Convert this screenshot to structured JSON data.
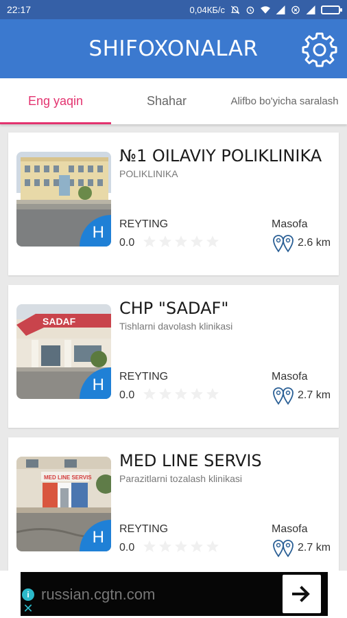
{
  "status_bar": {
    "time": "22:17",
    "network_speed": "0,04КБ/с",
    "icons": [
      "mute-icon",
      "alarm-icon",
      "wifi-icon",
      "signal-icon",
      "data-saver-icon",
      "signal-icon",
      "battery-icon"
    ]
  },
  "app_bar": {
    "title": "SHIFOXONALAR",
    "settings_icon": "gear-icon"
  },
  "tabs": [
    {
      "label": "Eng yaqin",
      "active": true
    },
    {
      "label": "Shahar",
      "active": false
    },
    {
      "label": "Alifbo bo'yicha saralash",
      "active": false
    }
  ],
  "hospitals": [
    {
      "name": "№1 OILAVIY POLIKLINIKA",
      "subtitle": "POLIKLINIKA",
      "rating_label": "REYTING",
      "rating": "0.0",
      "distance_label": "Masofa",
      "distance": "2.6 km",
      "badge": "H"
    },
    {
      "name": "CHP \"SADAF\"",
      "subtitle": "Tishlarni davolash klinikasi",
      "rating_label": "REYTING",
      "rating": "0.0",
      "distance_label": "Masofa",
      "distance": "2.7 km",
      "badge": "H"
    },
    {
      "name": "MED LINE SERVIS",
      "subtitle": "Parazitlarni tozalash klinikasi",
      "rating_label": "REYTING",
      "rating": "0.0",
      "distance_label": "Masofa",
      "distance": "2.7 km",
      "badge": "H"
    }
  ],
  "ad": {
    "text": "russian.cgtn.com",
    "info_icon": "info-icon",
    "close_icon": "close-icon",
    "arrow_icon": "arrow-right-icon"
  },
  "colors": {
    "status_bar": "#3560a7",
    "app_bar": "#3b79cf",
    "accent": "#e3336f",
    "badge": "#1f80d6"
  }
}
